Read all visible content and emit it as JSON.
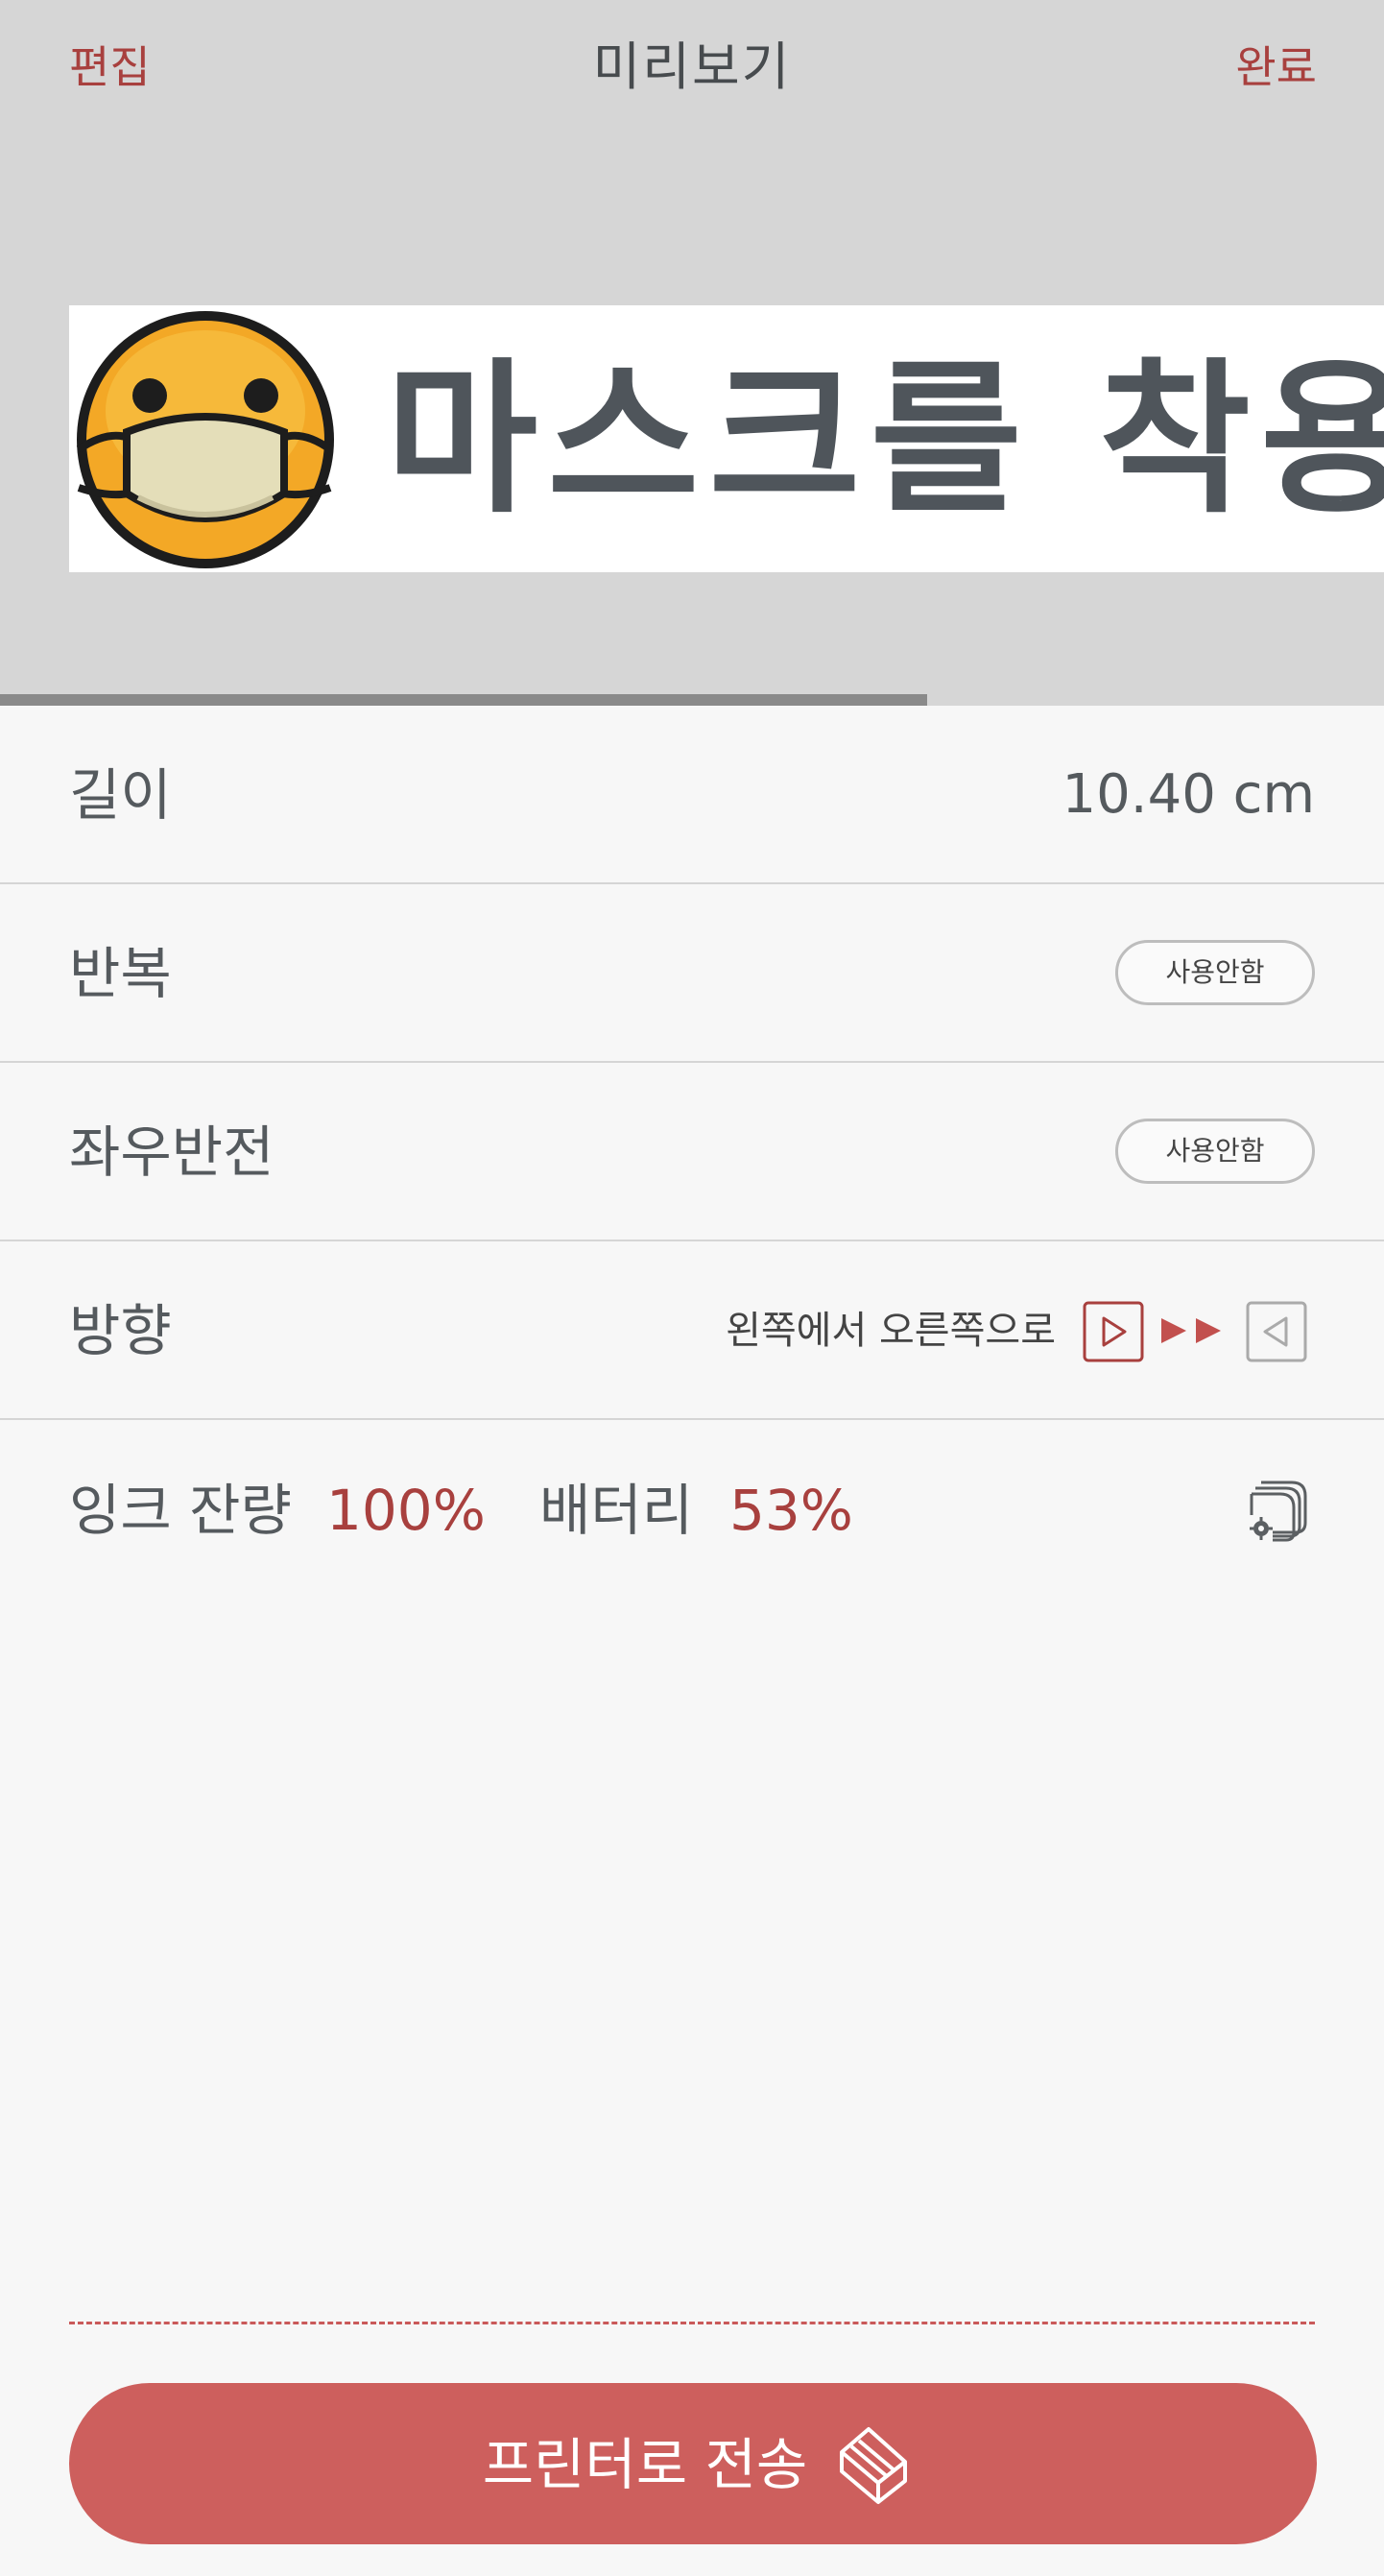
{
  "header": {
    "left_button": "편집",
    "title": "미리보기",
    "right_button": "완료"
  },
  "preview": {
    "banner_text": "마스크를 착용하",
    "emoji_icon": "face-with-mask-icon",
    "scroll_progress": 0.67
  },
  "settings": {
    "length": {
      "label": "길이",
      "value": "10.40 cm"
    },
    "repeat": {
      "label": "반복",
      "value": "사용안함"
    },
    "mirror": {
      "label": "좌우반전",
      "value": "사용안함"
    },
    "direction": {
      "label": "방향",
      "value": "왼쪽에서 오른쪽으로",
      "icons": [
        "play-right-icon",
        "double-arrow-right-icon",
        "play-left-icon"
      ]
    }
  },
  "status": {
    "ink_label": "잉크 잔량",
    "ink_value": "100%",
    "battery_label": "배터리",
    "battery_value": "53%",
    "settings_icon": "printer-settings-icon"
  },
  "footer": {
    "send_label": "프린터로 전송",
    "send_icon": "printer-stack-icon"
  },
  "colors": {
    "accent": "#a8403e",
    "button": "#cd5f5d",
    "header_bg": "#d6d6d6",
    "body_bg": "#f7f7f7"
  }
}
